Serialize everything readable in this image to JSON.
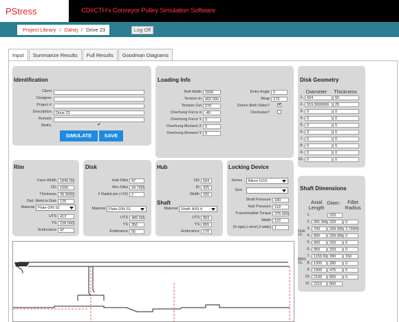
{
  "app": {
    "logo": "PStress",
    "banner": "CDI/CTH's Conveyor Pulley Simulation Software"
  },
  "breadcrumb": {
    "items": [
      "Project Library",
      "Dahej"
    ],
    "current": "Drive 23",
    "logoff": "Log Off"
  },
  "tabs": [
    "Input",
    "Summarize Results",
    "Full Results",
    "Goodman Diagrams"
  ],
  "identification": {
    "title": "Identification",
    "fields": [
      {
        "label": "Client",
        "value": ""
      },
      {
        "label": "Designer",
        "value": ""
      },
      {
        "label": "Project #",
        "value": ""
      },
      {
        "label": "Description",
        "value": "Drive 23"
      },
      {
        "label": "Remark",
        "value": ""
      }
    ],
    "metric_label": "Metric",
    "metric_check": "✔",
    "simulate": "SIMULATE",
    "save": "SAVE"
  },
  "loading": {
    "title": "Loading Info",
    "left": [
      {
        "label": "Belt Width",
        "value": "1600"
      },
      {
        "label": "Tension In",
        "value": "402.000"
      },
      {
        "label": "Tension Out",
        "value": "270"
      },
      {
        "label": "Overhung Force X",
        "value": "-40"
      },
      {
        "label": "Overhung Force Y",
        "value": "0"
      },
      {
        "label": "Overhung Moment X",
        "value": "0"
      },
      {
        "label": "Overhung Moment Y",
        "value": "0"
      }
    ],
    "right": [
      {
        "label": "Entry Angle",
        "value": "0"
      },
      {
        "label": "Wrap",
        "value": "173"
      }
    ],
    "driven_label": "Driven Both Sides?",
    "driven_check": "✔",
    "clockwise_label": "Clockwise?",
    "clockwise_check": ""
  },
  "disk_geometry": {
    "title": "Disk Geometry",
    "col1": "Diameter",
    "col2": "Thickness",
    "rows": [
      {
        "n": "1.",
        "d": "604",
        "t": "50"
      },
      {
        "n": "2.",
        "d": "919.9999999",
        "t": "25"
      },
      {
        "n": "3.",
        "d": "0",
        "t": "0"
      },
      {
        "n": "4.",
        "d": "0",
        "t": "0"
      },
      {
        "n": "5.",
        "d": "0",
        "t": "0"
      },
      {
        "n": "6.",
        "d": "0",
        "t": "0"
      },
      {
        "n": "7.",
        "d": "0",
        "t": "0"
      },
      {
        "n": "8.",
        "d": "0",
        "t": "0"
      },
      {
        "n": "9.",
        "d": "0",
        "t": "0"
      },
      {
        "n": "10.",
        "d": "0",
        "t": "0"
      }
    ]
  },
  "rim": {
    "title": "Rim",
    "fields": [
      {
        "label": "Face Width",
        "value": "1849.99"
      },
      {
        "label": "OD",
        "value": "1000"
      },
      {
        "label": "Thickness",
        "value": "39.9999"
      },
      {
        "label": "Dist. Weld to Disk",
        "value": "125"
      }
    ],
    "material_label": "Material",
    "material": "Plate-DIN S1",
    "props": [
      {
        "label": "UTS",
        "value": "413"
      },
      {
        "label": "YS",
        "value": "228.000"
      },
      {
        "label": "Endurance",
        "value": "47"
      }
    ]
  },
  "disk": {
    "title": "Disk",
    "fields": [
      {
        "label": "Hub Fillet",
        "value": "47"
      },
      {
        "label": "Rim Fillet",
        "value": "34.7999"
      },
      {
        "label": "# Radial pts (<10)",
        "value": "2"
      }
    ],
    "material_label": "Material",
    "material": "Plate-DIN S1",
    "props": [
      {
        "label": "UTS",
        "value": "489.999"
      },
      {
        "label": "YS",
        "value": "356"
      },
      {
        "label": "Endurance",
        "value": "56"
      }
    ]
  },
  "hub": {
    "title": "Hub",
    "fields": [
      {
        "label": "OD",
        "value": "604"
      },
      {
        "label": "ID",
        "value": "425"
      },
      {
        "label": "Width",
        "value": "200"
      }
    ],
    "shaft_title": "Shaft",
    "material_label": "Material",
    "material": "Shaft- AISI 4",
    "props": [
      {
        "label": "UTS",
        "value": "893"
      },
      {
        "label": "YS",
        "value": "855"
      },
      {
        "label": "Endurance",
        "value": "170"
      }
    ]
  },
  "locking": {
    "title": "Locking Device",
    "series_label": "Series",
    "series": "Bikon 1015",
    "size_label": "Size",
    "size": "",
    "fields": [
      {
        "label": "Shaft Pressure",
        "value": "180"
      },
      {
        "label": "Hub Pressure",
        "value": "119"
      },
      {
        "label": "Transmissible Torque",
        "value": "375.999"
      },
      {
        "label": "Width",
        "value": "110"
      },
      {
        "label": "(0-rigid,1-short,2-wide)",
        "value": "1"
      }
    ]
  },
  "shaft_dims": {
    "title": "Shaft Dimensions",
    "col1": "Axial Length",
    "col2": "Diam.",
    "col3": "Fillet Radius",
    "disk_cl": "Disk CL",
    "brg_cl": "BRG CL",
    "rows": [
      {
        "n": "1.",
        "a": "",
        "d": "333",
        "r": ""
      },
      {
        "n": "2.",
        "a": "281.9999",
        "d": "333",
        "r": "0"
      },
      {
        "n": "3.",
        "a": "700",
        "d": "339.999",
        "r": "2.79999"
      },
      {
        "n": "4.",
        "a": "800",
        "d": "339.999",
        "r": "0"
      },
      {
        "n": "5.",
        "a": "900",
        "d": "333",
        "r": "0"
      },
      {
        "n": "6.",
        "a": "950",
        "d": "333",
        "r": "0"
      },
      {
        "n": "7.",
        "a": "1159.99",
        "d": "280",
        "r": "150"
      },
      {
        "n": "8.",
        "a": "1300",
        "d": "280",
        "r": "0"
      },
      {
        "n": "9.",
        "a": "1900",
        "d": "475",
        "r": "0"
      },
      {
        "n": "10.",
        "a": "2100",
        "d": "800",
        "r": "0"
      },
      {
        "n": "11.",
        "a": "2210",
        "d": "800",
        "r": ""
      }
    ]
  },
  "colors": {
    "accent": "#1f8ae0",
    "nav": "#2c7f93",
    "banner_text": "#ff3344",
    "centerline": "#e23333"
  }
}
